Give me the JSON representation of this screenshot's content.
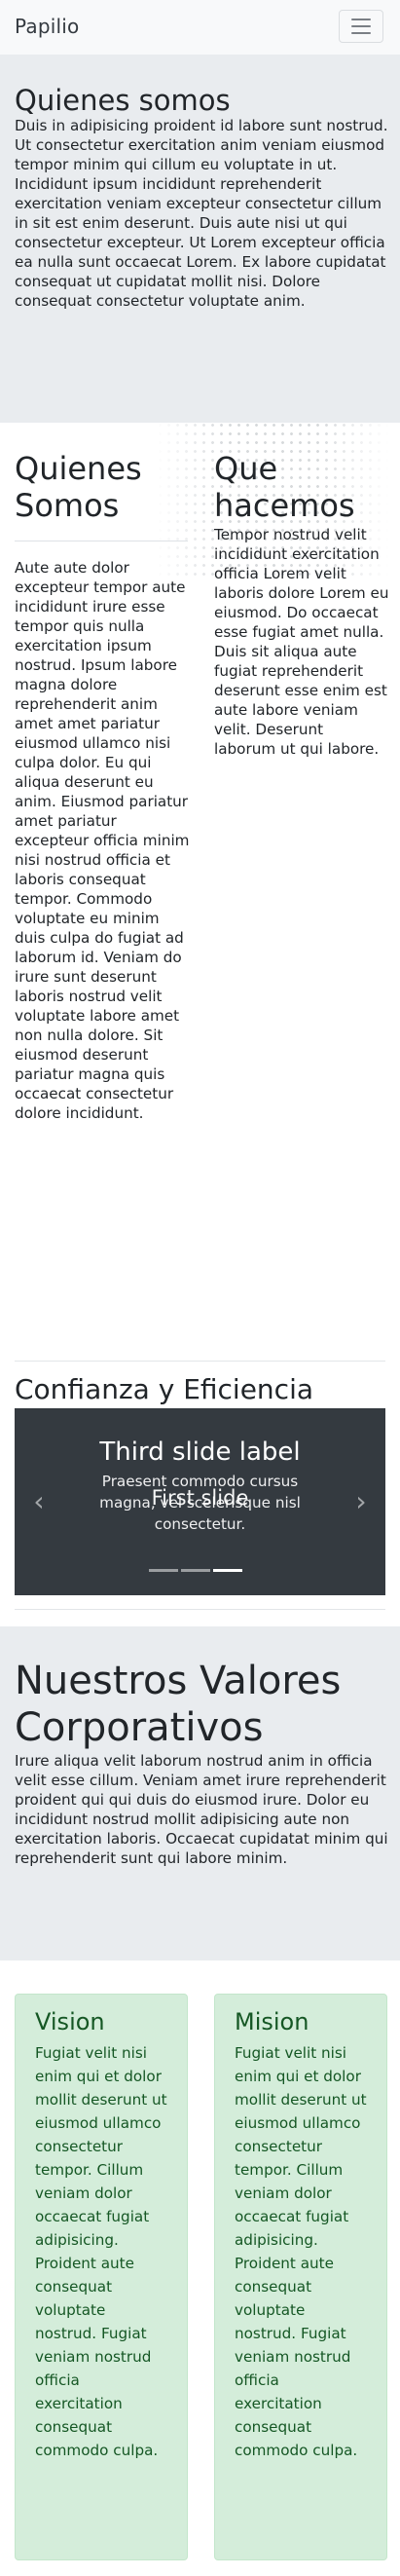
{
  "navbar": {
    "brand": "Papilio",
    "toggler_icon": "hamburger-menu-icon"
  },
  "hero": {
    "title": "Quienes somos",
    "text": "Duis in adipisicing proident id labore sunt nostrud. Ut consectetur exercitation anim veniam eiusmod tempor minim qui cillum eu voluptate in ut. Incididunt ipsum incididunt reprehenderit exercitation veniam excepteur consectetur cillum in sit est enim deserunt. Duis aute nisi ut qui consectetur excepteur. Ut Lorem excepteur officia ea nulla sunt occaecat Lorem. Ex labore cupidatat consequat ut cupidatat mollit nisi. Dolore consequat consectetur voluptate anim."
  },
  "columns": {
    "left": {
      "title": "Quienes Somos",
      "text": "Aute aute dolor excepteur tempor aute incididunt irure esse tempor quis nulla exercitation ipsum nostrud. Ipsum labore magna dolore reprehenderit anim amet amet pariatur eiusmod ullamco nisi culpa dolor. Eu qui aliqua deserunt eu anim. Eiusmod pariatur amet pariatur excepteur officia minim nisi nostrud officia et laboris consequat tempor. Commodo voluptate eu minim duis culpa do fugiat ad laborum id. Veniam do irure sunt deserunt laboris nostrud velit voluptate labore amet non nulla dolore. Sit eiusmod deserunt pariatur magna quis occaecat consectetur dolore incididunt."
    },
    "right": {
      "title": "Que hacemos",
      "text": "Tempor nostrud velit incididunt exercitation officia Lorem velit laboris dolore Lorem eu eiusmod. Do occaecat esse fugiat amet nulla. Duis sit aliqua aute fugiat reprehenderit deserunt esse enim est aute labore veniam velit. Deserunt laborum ut qui labore."
    }
  },
  "carousel": {
    "section_title": "Confianza y Eficiencia",
    "caption_title": "Third slide label",
    "caption_text": "Praesent commodo cursus magna, vel scelerisque nisl consectetur.",
    "ghost_label": "First slide",
    "prev_icon": "chevron-left-icon",
    "next_icon": "chevron-right-icon",
    "indicator_count": 3,
    "active_indicator": 2
  },
  "values": {
    "title": "Nuestros Valores Corporativos",
    "text": "Irure aliqua velit laborum nostrud anim in officia velit esse cillum. Veniam amet irure reprehenderit proident qui qui duis do eiusmod irure. Dolor eu incididunt nostrud mollit adipisicing aute non exercitation laboris. Occaecat cupidatat minim qui reprehenderit sunt qui labore minim."
  },
  "cards": {
    "vision": {
      "title": "Vision",
      "text": "Fugiat velit nisi enim qui et dolor mollit deserunt ut eiusmod ullamco consectetur tempor. Cillum veniam dolor occaecat fugiat adipisicing. Proident aute consequat voluptate nostrud. Fugiat veniam nostrud officia exercitation consequat commodo culpa."
    },
    "mision": {
      "title": "Mision",
      "text": "Fugiat velit nisi enim qui et dolor mollit deserunt ut eiusmod ullamco consectetur tempor. Cillum veniam dolor occaecat fugiat adipisicing. Proident aute consequat voluptate nostrud. Fugiat veniam nostrud officia exercitation consequat commodo culpa."
    },
    "colors": {
      "background": "#d4edda",
      "text": "#155724"
    }
  }
}
